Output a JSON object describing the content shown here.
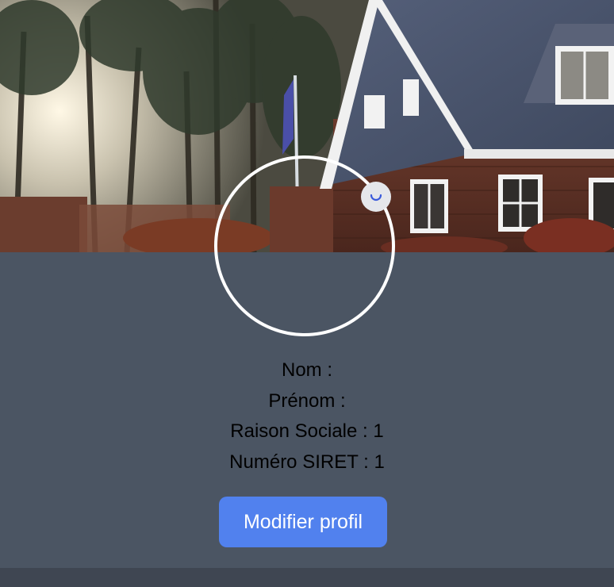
{
  "profile": {
    "fields": [
      {
        "label": "Nom :",
        "value": ""
      },
      {
        "label": "Prénom :",
        "value": ""
      },
      {
        "label": "Raison Sociale :",
        "value": "1"
      },
      {
        "label": "Numéro SIRET :",
        "value": "1"
      }
    ],
    "edit_button_label": "Modifier profil"
  },
  "icons": {
    "cover": "house-cover-photo",
    "avatar": "profile-avatar",
    "edit": "loading-spinner-icon"
  },
  "colors": {
    "background": "#4b5563",
    "button": "#5181ee",
    "avatar_border": "#ffffff"
  }
}
